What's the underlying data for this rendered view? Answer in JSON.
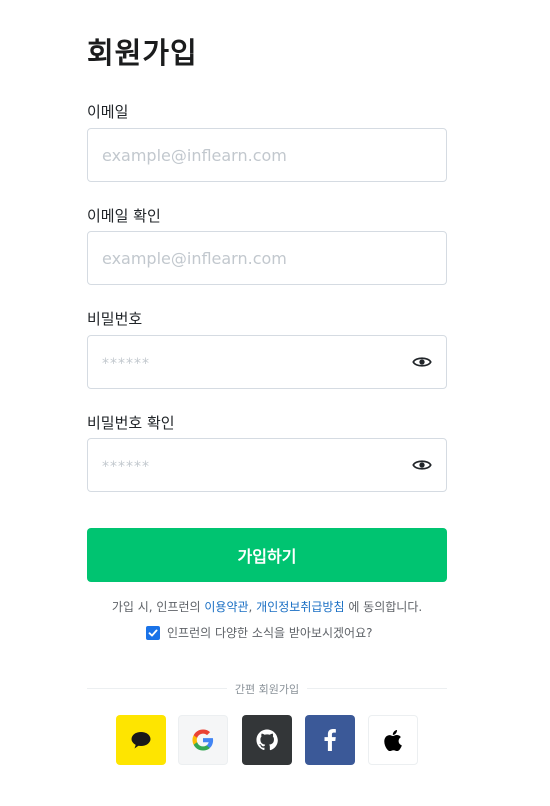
{
  "title": "회원가입",
  "fields": [
    {
      "label": "이메일",
      "placeholder": "example@inflearn.com",
      "type": "text"
    },
    {
      "label": "이메일 확인",
      "placeholder": "example@inflearn.com",
      "type": "text"
    },
    {
      "label": "비밀번호",
      "placeholder": "******",
      "type": "password"
    },
    {
      "label": "비밀번호 확인",
      "placeholder": "******",
      "type": "password"
    }
  ],
  "submit_label": "가입하기",
  "terms": {
    "prefix": "가입 시, 인프런의 ",
    "terms_link": "이용약관",
    "sep": ", ",
    "privacy_link": "개인정보취급방침",
    "suffix": " 에 동의합니다."
  },
  "optin": {
    "label": "인프런의 다양한 소식을 받아보시겠어요?",
    "checked": true
  },
  "social": {
    "label": "간편 회원가입",
    "providers": [
      "kakao-icon",
      "google-icon",
      "github-icon",
      "facebook-icon",
      "apple-icon"
    ]
  },
  "colors": {
    "primary": "#00c471",
    "kakao": "#fee500",
    "github": "#333638",
    "facebook": "#3b5998",
    "link": "#1a6fc4"
  }
}
